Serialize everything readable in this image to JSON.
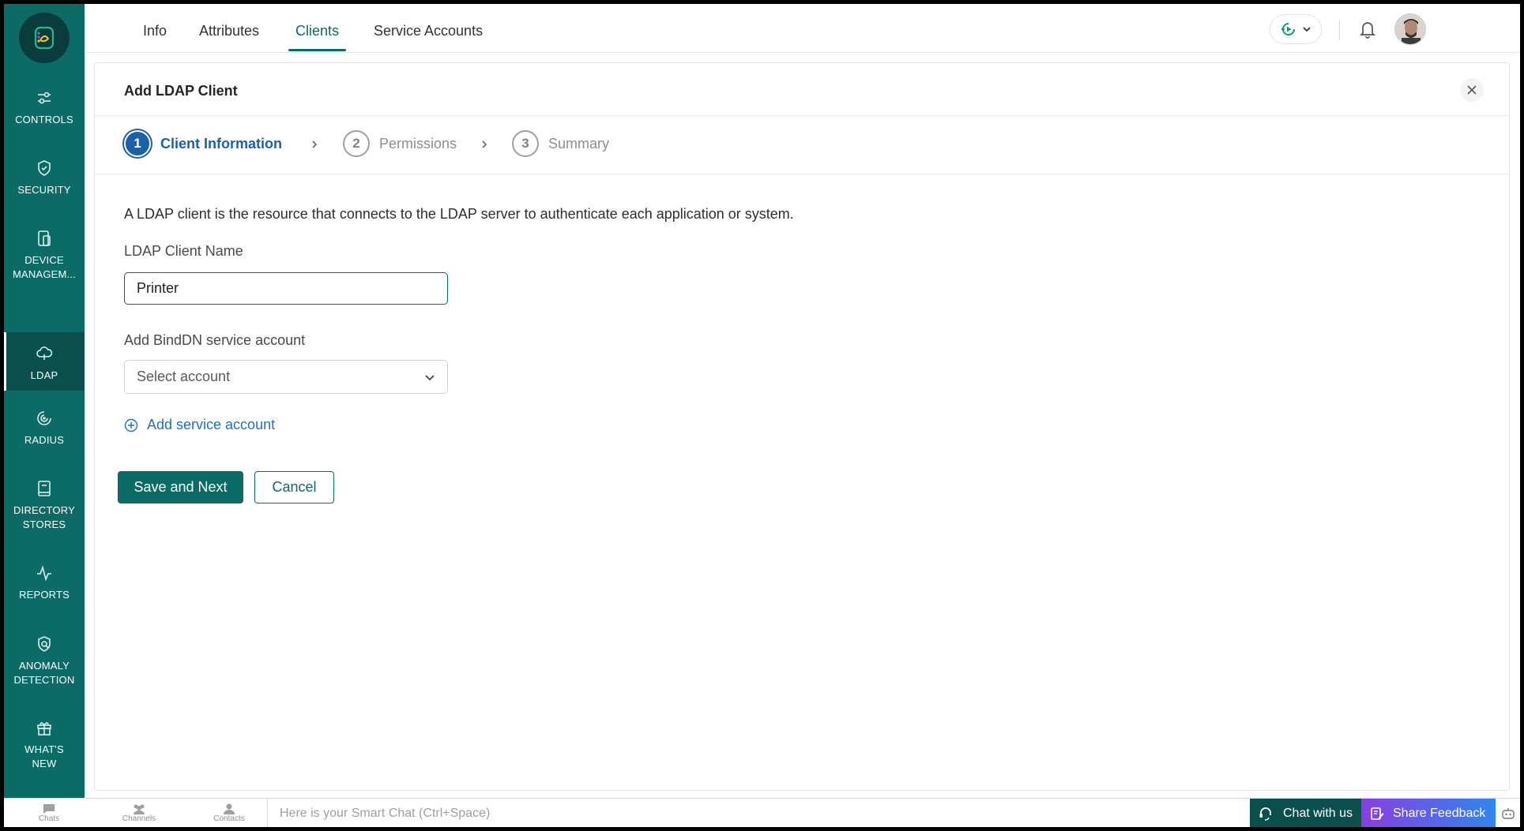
{
  "sidebar": {
    "items": [
      {
        "label": "CONTROLS",
        "icon": "sliders-icon"
      },
      {
        "label": "SECURITY",
        "icon": "shield-check-icon"
      },
      {
        "label": "DEVICE\nMANAGEM...",
        "icon": "devices-icon"
      },
      {
        "label": "LDAP",
        "icon": "cloud-icon"
      },
      {
        "label": "RADIUS",
        "icon": "radius-icon"
      },
      {
        "label": "DIRECTORY\nSTORES",
        "icon": "book-icon"
      },
      {
        "label": "REPORTS",
        "icon": "pulse-icon"
      },
      {
        "label": "ANOMALY\nDETECTION",
        "icon": "shield-search-icon"
      },
      {
        "label": "WHAT'S\nNEW",
        "icon": "gift-icon"
      }
    ]
  },
  "header": {
    "tabs": [
      {
        "label": "Info"
      },
      {
        "label": "Attributes"
      },
      {
        "label": "Clients"
      },
      {
        "label": "Service Accounts"
      }
    ],
    "active_tab": "Clients"
  },
  "dialog": {
    "title": "Add LDAP Client",
    "steps": [
      {
        "num": "1",
        "label": "Client Information"
      },
      {
        "num": "2",
        "label": "Permissions"
      },
      {
        "num": "3",
        "label": "Summary"
      }
    ],
    "description": "A LDAP client is the resource that connects to the LDAP server to authenticate each application or system.",
    "client_name_label": "LDAP Client Name",
    "client_name_value": "Printer",
    "binddn_label": "Add BindDN service account",
    "binddn_placeholder": "Select account",
    "add_service_account": "Add service account",
    "save_next": "Save and Next",
    "cancel": "Cancel"
  },
  "bottombar": {
    "chats": "Chats",
    "channels": "Channels",
    "contacts": "Contacts",
    "smart_chat_placeholder": "Here is your Smart Chat (Ctrl+Space)",
    "chat_with_us": "Chat with us",
    "share_feedback": "Share Feedback"
  },
  "colors": {
    "brand": "#0c6b66",
    "step_active": "#1d5fa8",
    "link": "#1d6fc8"
  }
}
